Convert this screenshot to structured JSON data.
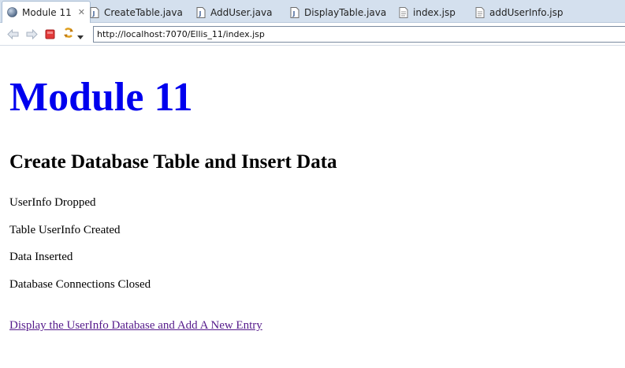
{
  "tabs": [
    {
      "label": "Module 11",
      "icon": "globe-icon",
      "active": true
    },
    {
      "label": "CreateTable.java",
      "icon": "java-file-icon"
    },
    {
      "label": "AddUser.java",
      "icon": "java-file-icon"
    },
    {
      "label": "DisplayTable.java",
      "icon": "java-file-icon"
    },
    {
      "label": "index.jsp",
      "icon": "jsp-file-icon"
    },
    {
      "label": "addUserInfo.jsp",
      "icon": "jsp-file-icon"
    }
  ],
  "toolbar": {
    "url": "http://localhost:7070/Ellis_11/index.jsp"
  },
  "page": {
    "heading": "Module 11",
    "subheading": "Create Database Table and Insert Data",
    "messages": [
      "UserInfo Dropped",
      "Table UserInfo Created",
      "Data Inserted",
      "Database Connections Closed"
    ],
    "link": "Display the UserInfo Database and Add A New Entry"
  },
  "colors": {
    "heading": "#0000ee",
    "visited_link": "#551a8b",
    "tab_strip": "#d4e0ee"
  }
}
